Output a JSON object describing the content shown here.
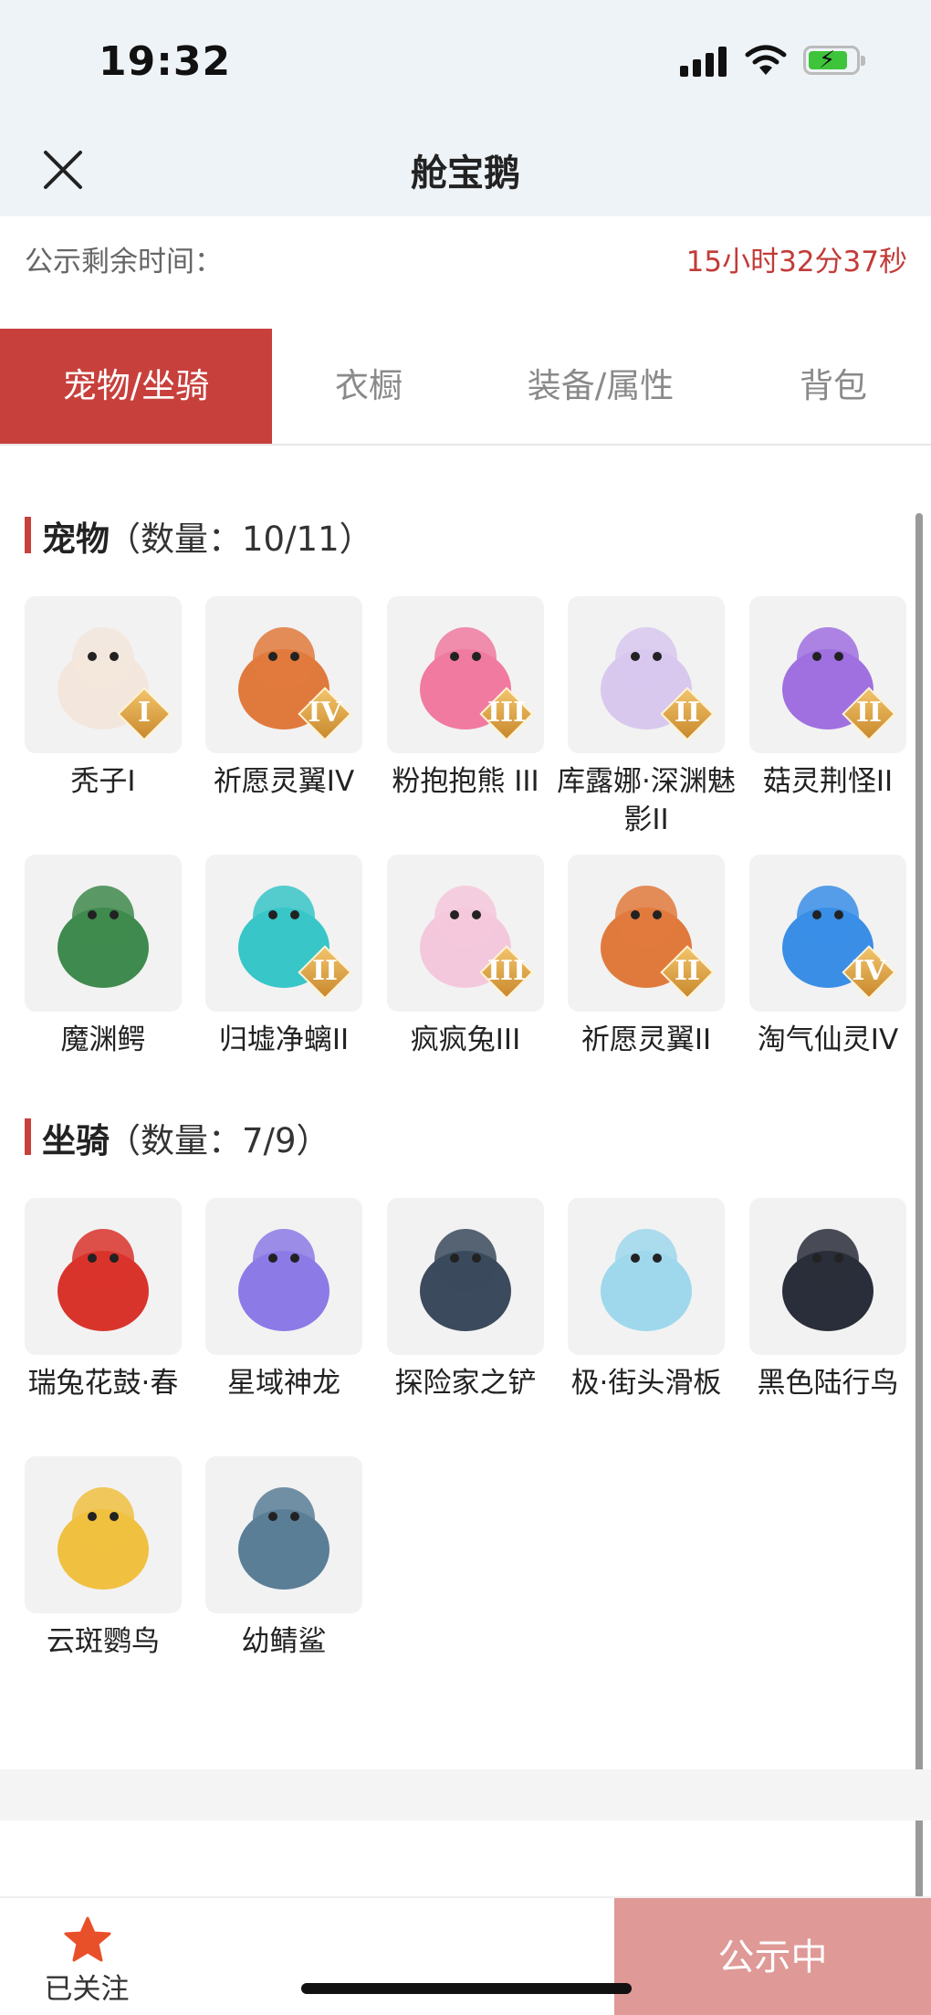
{
  "status": {
    "time": "19:32"
  },
  "nav": {
    "title": "舱宝鹅"
  },
  "notice": {
    "label": "公示剩余时间：",
    "remaining": "15小时32分37秒"
  },
  "tabs": [
    {
      "label": "宠物/坐骑",
      "active": true
    },
    {
      "label": "衣橱",
      "active": false
    },
    {
      "label": "装备/属性",
      "active": false
    },
    {
      "label": "背包",
      "active": false
    }
  ],
  "pets": {
    "title": "宠物",
    "count": "（数量：10/11）",
    "items": [
      {
        "name": "秃子I",
        "grade": "I",
        "icon": "bald-character-icon",
        "color": "#f3e6dc"
      },
      {
        "name": "祈愿灵翼IV",
        "grade": "IV",
        "icon": "eagle-icon",
        "color": "#e07a3c"
      },
      {
        "name": "粉抱抱熊 III",
        "grade": "III",
        "icon": "pink-bear-icon",
        "color": "#f07aa0"
      },
      {
        "name": "库露娜·深渊魅影II",
        "grade": "II",
        "icon": "abyss-girl-icon",
        "color": "#d8c8ee"
      },
      {
        "name": "菇灵荆怪II",
        "grade": "II",
        "icon": "mushroom-elf-icon",
        "color": "#a070e0"
      },
      {
        "name": "魔渊鳄",
        "grade": "",
        "icon": "crocodile-icon",
        "color": "#3f8a4e"
      },
      {
        "name": "归墟净螭II",
        "grade": "II",
        "icon": "water-dragon-icon",
        "color": "#38c6c8"
      },
      {
        "name": "疯疯兔III",
        "grade": "III",
        "icon": "rabbit-icon",
        "color": "#f4c8dc"
      },
      {
        "name": "祈愿灵翼II",
        "grade": "II",
        "icon": "eagle-icon",
        "color": "#e07a3c"
      },
      {
        "name": "淘气仙灵IV",
        "grade": "IV",
        "icon": "blue-puppy-icon",
        "color": "#3a8ee6"
      }
    ]
  },
  "mounts": {
    "title": "坐骑",
    "count": "（数量：7/9）",
    "items": [
      {
        "name": "瑞兔花鼓·春",
        "icon": "drum-icon",
        "color": "#d9342b"
      },
      {
        "name": "星域神龙",
        "icon": "star-dragon-icon",
        "color": "#8c7ae6"
      },
      {
        "name": "探险家之铲",
        "icon": "shovel-icon",
        "color": "#3b4a5c"
      },
      {
        "name": "极·街头滑板",
        "icon": "skateboard-icon",
        "color": "#9fd8ec"
      },
      {
        "name": "黑色陆行鸟",
        "icon": "black-bird-icon",
        "color": "#2a2e3a"
      },
      {
        "name": "云斑鹦鸟",
        "icon": "parrot-icon",
        "color": "#f0c040"
      },
      {
        "name": "幼鲭鲨",
        "icon": "shark-icon",
        "color": "#5a7e96"
      }
    ]
  },
  "bottom": {
    "follow_label": "已关注",
    "public_label": "公示中"
  },
  "colors": {
    "accent": "#c8403c",
    "notice_time": "#c23b38",
    "public_button": "#df9996",
    "star": "#e8502a"
  }
}
